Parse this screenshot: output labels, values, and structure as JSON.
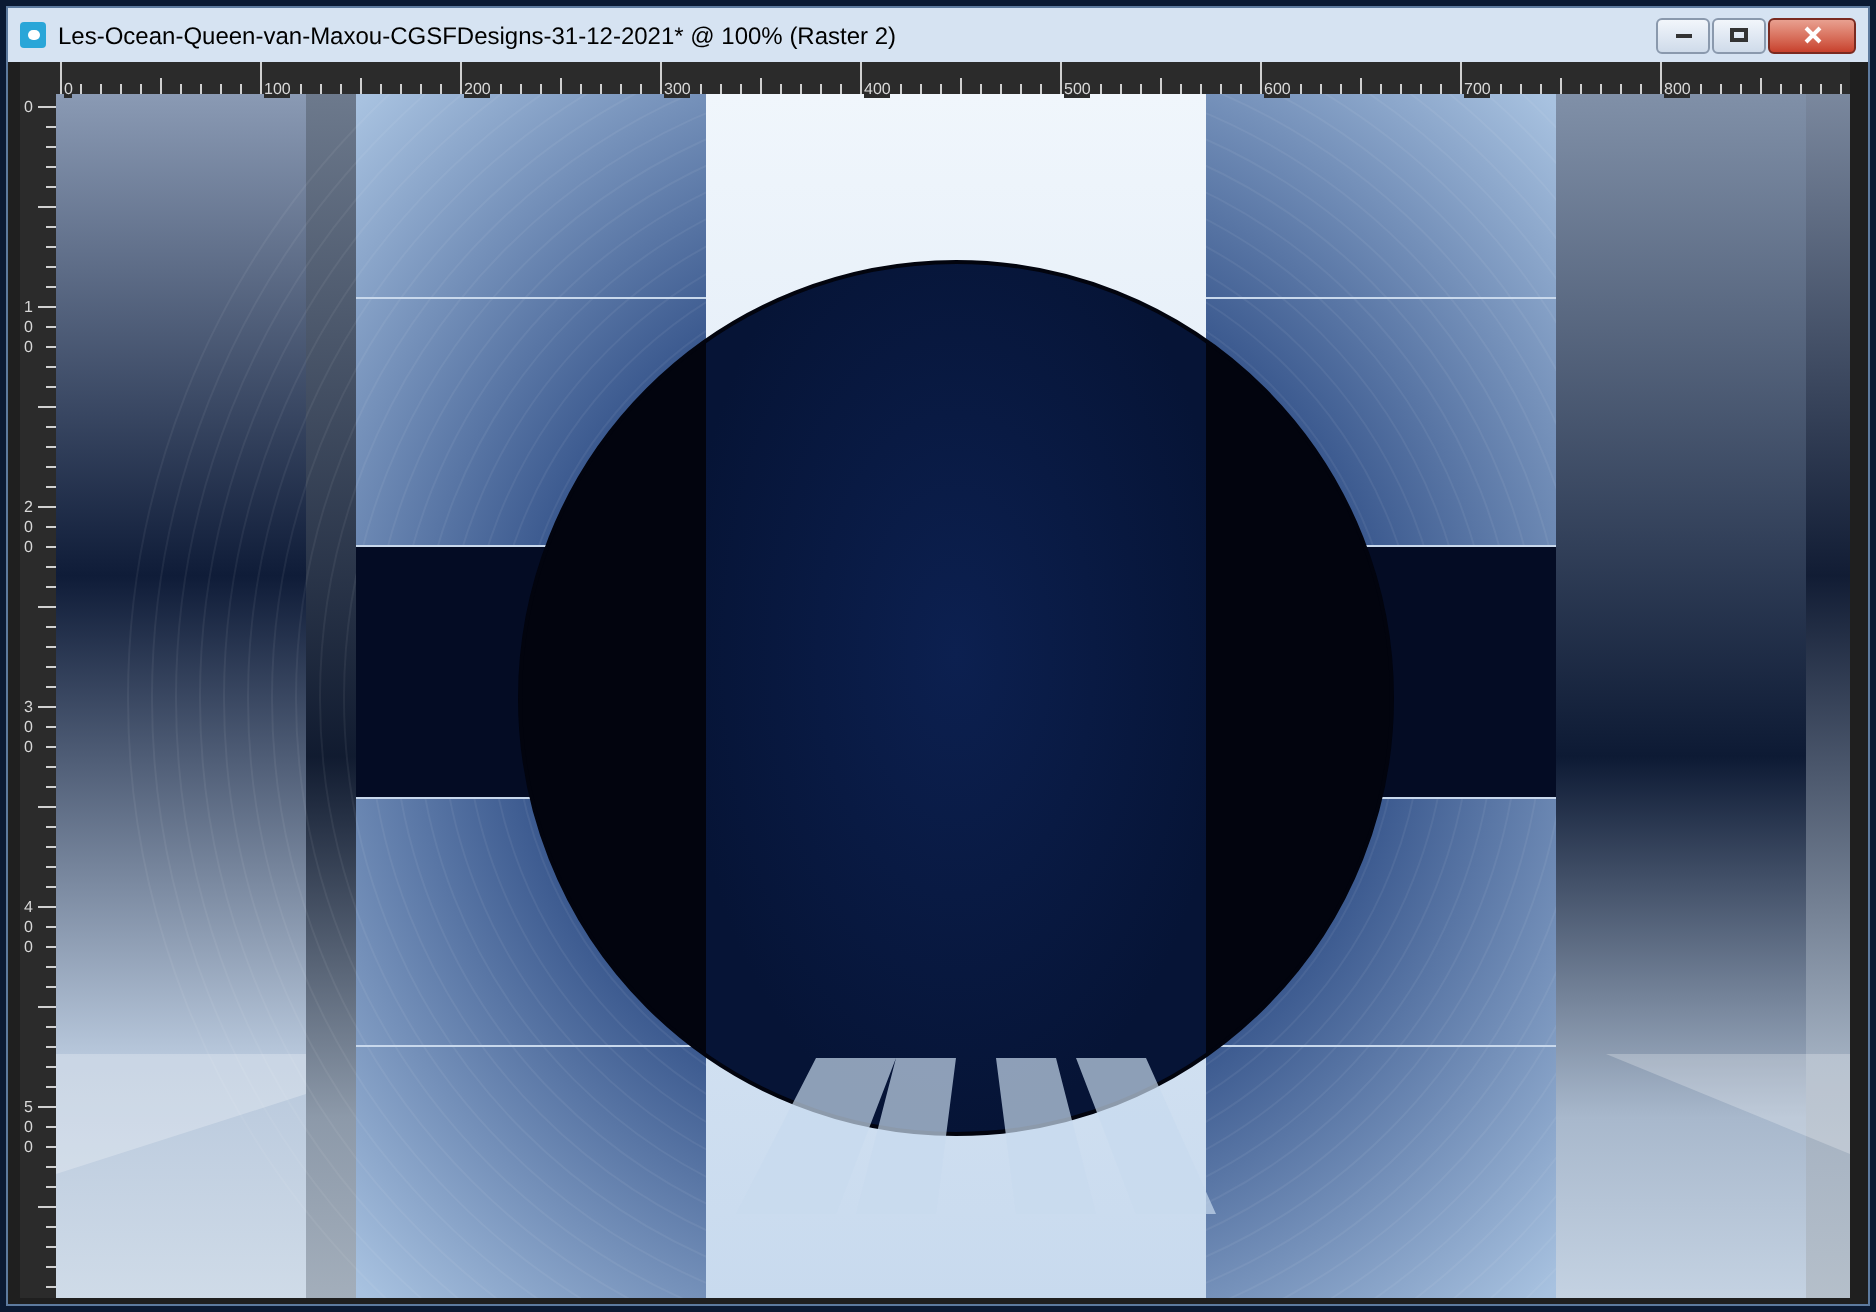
{
  "window": {
    "title": "Les-Ocean-Queen-van-Maxou-CGSFDesigns-31-12-2021* @ 100% (Raster 2)"
  },
  "ruler_horizontal": [
    "0",
    "100",
    "200",
    "300",
    "400",
    "500",
    "600",
    "700",
    "800"
  ],
  "ruler_vertical": [
    "0",
    "100",
    "200",
    "300",
    "400",
    "500"
  ]
}
